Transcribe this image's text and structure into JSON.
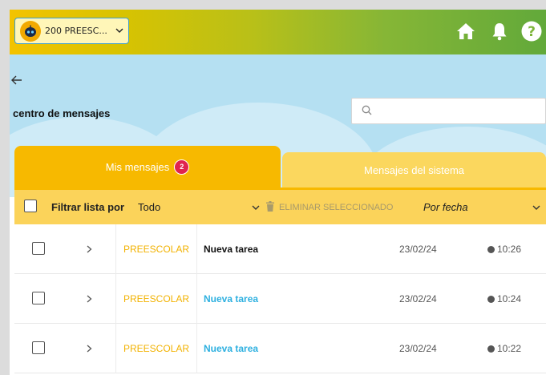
{
  "header": {
    "class_selector": "200 PREESC...",
    "icons": [
      "home-icon",
      "bell-icon",
      "help-icon"
    ]
  },
  "page": {
    "back_icon": "arrow-left-icon",
    "title": "centro de mensajes",
    "search_placeholder": ""
  },
  "tabs": {
    "mine_label": "Mis mensajes",
    "mine_badge": "2",
    "system_label": "Mensajes del sistema"
  },
  "filter": {
    "label": "Filtrar lista por",
    "value": "Todo",
    "delete_label": "ELIMINAR SELECCIONADO",
    "sort_value": "Por fecha"
  },
  "messages": [
    {
      "category": "PREESCOLAR",
      "subject": "Nueva tarea",
      "date": "23/02/24",
      "time": "10:26",
      "unread": false
    },
    {
      "category": "PREESCOLAR",
      "subject": "Nueva tarea",
      "date": "23/02/24",
      "time": "10:24",
      "unread": true
    },
    {
      "category": "PREESCOLAR",
      "subject": "Nueva tarea",
      "date": "23/02/24",
      "time": "10:22",
      "unread": true
    }
  ],
  "colors": {
    "accent_yellow": "#f7b900",
    "sky_blue": "#b5e0f2",
    "unread_blue": "#2db0e0",
    "badge_red": "#e0244f"
  }
}
